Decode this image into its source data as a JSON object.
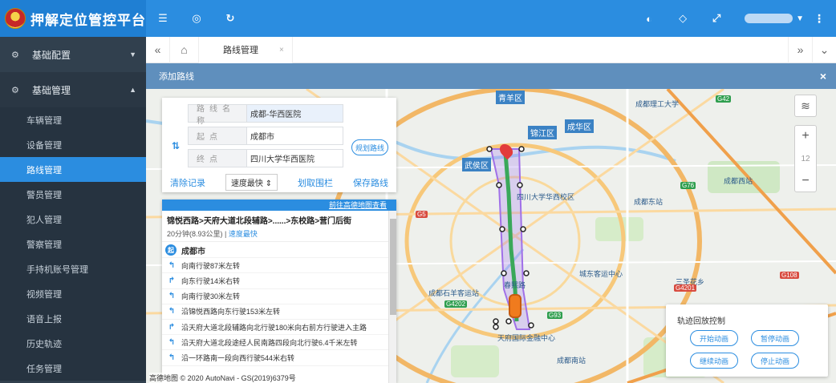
{
  "header": {
    "title": "押解定位管控平台",
    "icons": [
      "menu-icon",
      "globe-icon",
      "refresh-icon",
      "palette-icon",
      "tag-icon",
      "fullscreen-icon",
      "more-icon"
    ]
  },
  "sidebar": {
    "groups": [
      {
        "label": "基础配置",
        "expanded": false
      },
      {
        "label": "基础管理",
        "expanded": true
      }
    ],
    "items": [
      "车辆管理",
      "设备管理",
      "路线管理",
      "警员管理",
      "犯人管理",
      "警察管理",
      "手持机账号管理",
      "视频管理",
      "语音上报",
      "历史轨迹",
      "任务管理"
    ],
    "active_item": "路线管理"
  },
  "tabs": {
    "active": "路线管理",
    "close": "×"
  },
  "dialog": {
    "title": "添加路线",
    "close": "×"
  },
  "form": {
    "name_label": "路线名称",
    "name_value": "成都-华西医院",
    "start_label": "起点",
    "start_value": "成都市",
    "end_label": "终点",
    "end_value": "四川大学华西医院",
    "swap_icon": "⇅",
    "plan_button": "规划路线",
    "clear_button": "清除记录",
    "mode_select": "速度最快 ⇕",
    "fence_button": "划取围栏",
    "save_button": "保存路线"
  },
  "detail": {
    "link": "前往高德地图查看",
    "route": "锦悦西路>天府大道北段辅路>......>东校路>营门后街",
    "time_dist": "20分钟(8.93公里) |",
    "mode": "速度最快",
    "start_label": "成都市",
    "start_badge": "起",
    "steps": [
      {
        "icon": "↰",
        "text": "向南行驶87米左转"
      },
      {
        "icon": "↱",
        "text": "向东行驶14米右转"
      },
      {
        "icon": "↰",
        "text": "向南行驶30米左转"
      },
      {
        "icon": "↰",
        "text": "沿锦悦西路向东行驶153米左转"
      },
      {
        "icon": "↱",
        "text": "沿天府大道北段辅路向北行驶180米向右前方行驶进入主路"
      },
      {
        "icon": "↰",
        "text": "沿天府大道北段途经人民南路四段向北行驶6.4千米左转"
      },
      {
        "icon": "↰",
        "text": "沿一环路南一段向西行驶544米右转"
      }
    ]
  },
  "map": {
    "copyright": "高德地图 © 2020 AutoNavi - GS(2019)6379号",
    "zoom_level": "12",
    "areas": [
      "青羊区",
      "锦江区",
      "成华区",
      "武侯区"
    ],
    "places": [
      "成都理工大学",
      "四川大学华西校区",
      "成都东站",
      "成都石羊客运站",
      "城东客运中心",
      "三圣花乡",
      "天府国际金融中心",
      "春熙路",
      "成都南站",
      "成都西站"
    ],
    "roads": [
      "G42",
      "G5",
      "G76",
      "G108",
      "G4201",
      "G4202",
      "G93"
    ]
  },
  "playback": {
    "title": "轨迹回放控制",
    "start": "开始动画",
    "pause": "暂停动画",
    "resume": "继续动画",
    "stop": "停止动画"
  }
}
